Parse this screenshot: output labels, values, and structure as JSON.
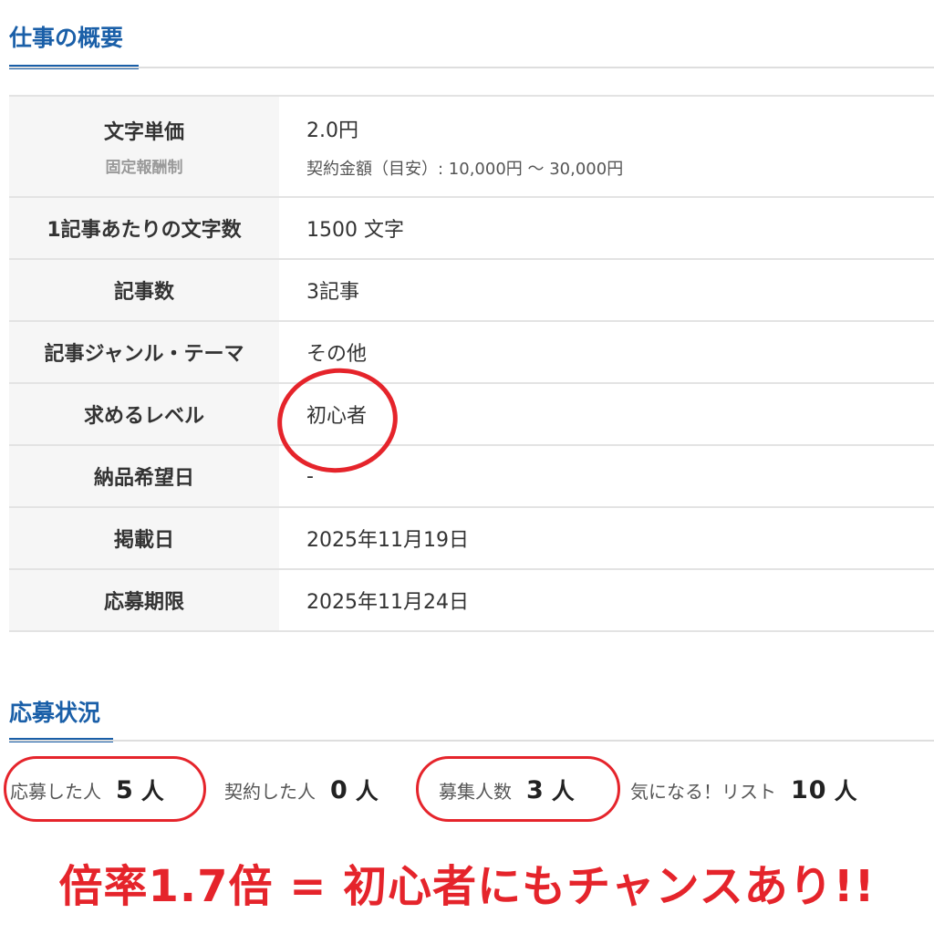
{
  "overview": {
    "heading": "仕事の概要",
    "rows": [
      {
        "label": "文字単価",
        "sublabel": "固定報酬制",
        "value": "2.0円",
        "subvalue": "契約金額（目安）: 10,000円 〜 30,000円"
      },
      {
        "label": "1記事あたりの文字数",
        "value": "1500 文字"
      },
      {
        "label": "記事数",
        "value": "3記事"
      },
      {
        "label": "記事ジャンル・テーマ",
        "value": "その他"
      },
      {
        "label": "求めるレベル",
        "value": "初心者"
      },
      {
        "label": "納品希望日",
        "value": "-"
      },
      {
        "label": "掲載日",
        "value": "2025年11月19日"
      },
      {
        "label": "応募期限",
        "value": "2025年11月24日"
      }
    ]
  },
  "status": {
    "heading": "応募状況",
    "items": [
      {
        "label": "応募した人",
        "count": "5",
        "unit": "人"
      },
      {
        "label": "契約した人",
        "count": "0",
        "unit": "人"
      },
      {
        "label": "募集人数",
        "count": "3",
        "unit": "人"
      },
      {
        "label": "気になる！リスト",
        "count": "10",
        "unit": "人"
      }
    ]
  },
  "tagline": "倍率1.7倍 = 初心者にもチャンスあり!!",
  "colors": {
    "accent": "#1a5fa8",
    "highlight": "#e5242b"
  }
}
